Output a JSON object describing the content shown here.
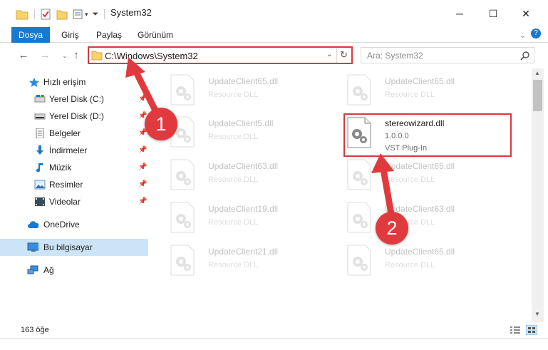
{
  "window": {
    "title": "System32",
    "minimize": "─",
    "maximize": "☐",
    "close": "✕"
  },
  "ribbon": {
    "tabs": [
      "Dosya",
      "Giriş",
      "Paylaş",
      "Görünüm"
    ],
    "help": "?"
  },
  "nav": {
    "address": "C:\\Windows\\System32",
    "search_placeholder": "Ara: System32"
  },
  "sidebar": {
    "items": [
      {
        "label": "Hızlı erişim",
        "icon": "star-icon"
      },
      {
        "label": "Yerel Disk (C:)",
        "icon": "drive-icon"
      },
      {
        "label": "Yerel Disk (D:)",
        "icon": "drive-icon"
      },
      {
        "label": "Belgeler",
        "icon": "documents-icon"
      },
      {
        "label": "İndirmeler",
        "icon": "downloads-icon"
      },
      {
        "label": "Müzik",
        "icon": "music-icon"
      },
      {
        "label": "Resimler",
        "icon": "pictures-icon"
      },
      {
        "label": "Videolar",
        "icon": "videos-icon"
      },
      {
        "label": "OneDrive",
        "icon": "cloud-icon"
      },
      {
        "label": "Bu bilgisayar",
        "icon": "computer-icon"
      },
      {
        "label": "Ağ",
        "icon": "network-icon"
      }
    ]
  },
  "files": {
    "col1": [
      {
        "name": "UpdateClient65.dll",
        "desc": "Resource DLL"
      },
      {
        "name": "UpdateClient5.dll",
        "desc": "Resource DLL"
      },
      {
        "name": "UpdateClient63.dll",
        "desc": "Resource DLL"
      },
      {
        "name": "UpdateClient19.dll",
        "desc": "Resource DLL"
      },
      {
        "name": "UpdateClient21.dll",
        "desc": "Resource DLL"
      }
    ],
    "col2": [
      {
        "name": "UpdateClient65.dll",
        "desc": "Resource DLL"
      },
      {
        "name": "UpdateClient65.dll",
        "desc": "Resource DLL"
      },
      {
        "name": "UpdateClient63.dll",
        "desc": "Resource DLL"
      },
      {
        "name": "UpdateClient65.dll",
        "desc": "Resource DLL"
      }
    ],
    "highlighted": {
      "name": "stereowizard.dll",
      "version": "1.0.0.0",
      "type": "VST Plug-In"
    }
  },
  "annotations": {
    "badge1": "1",
    "badge2": "2",
    "color": "#e03a3e"
  },
  "status": {
    "count": "163 öğe"
  }
}
